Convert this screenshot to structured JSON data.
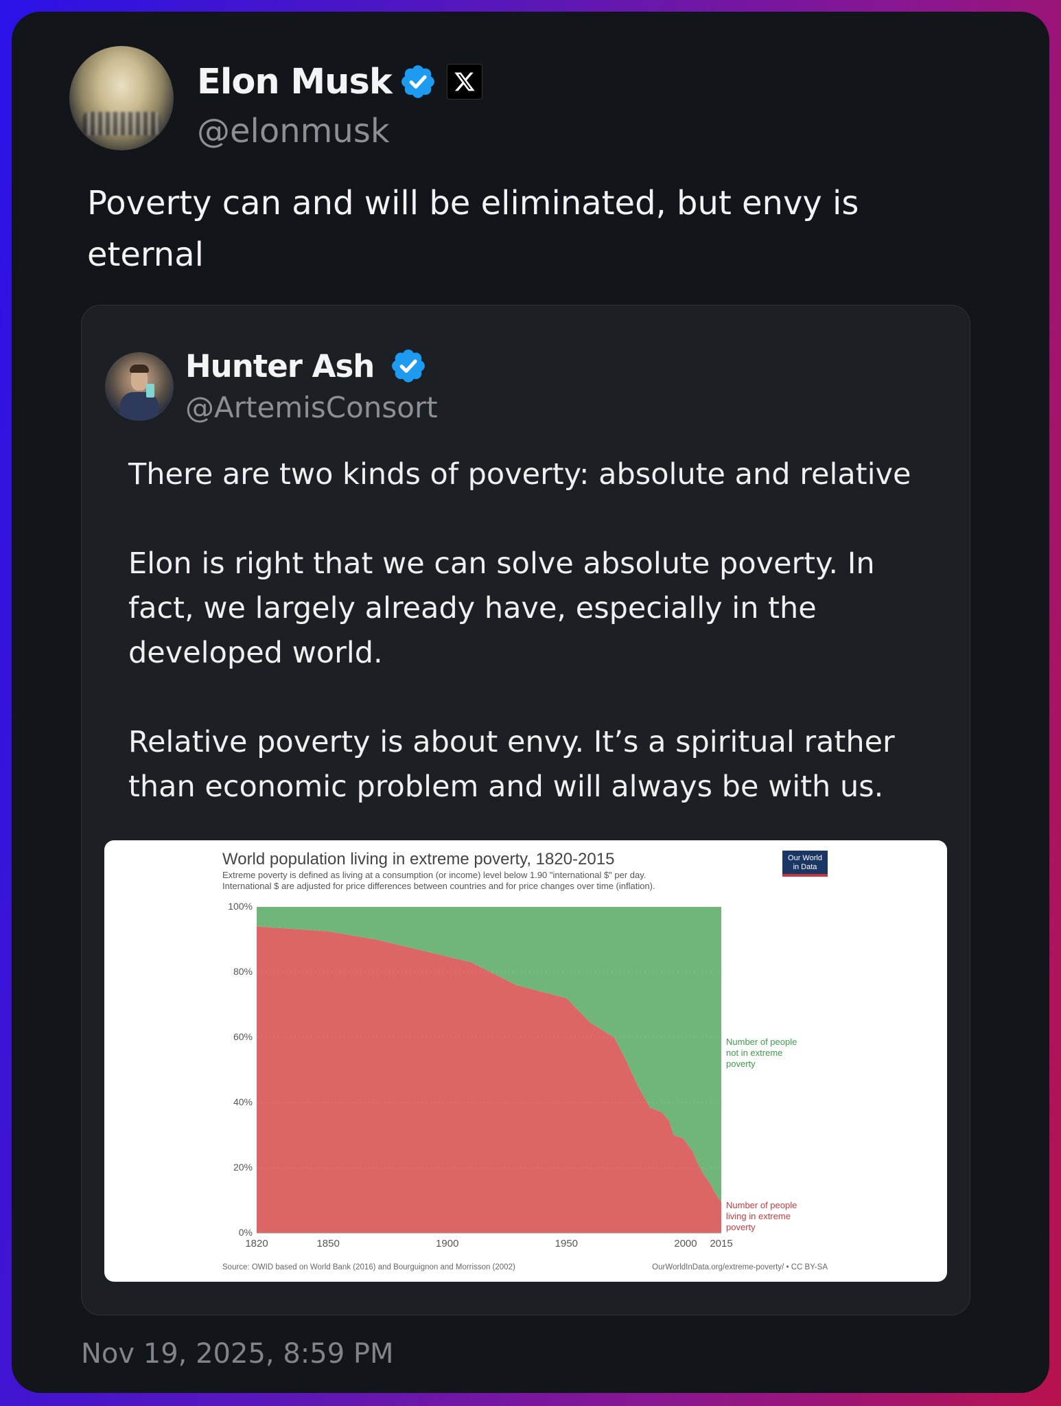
{
  "post": {
    "author": {
      "name": "Elon Musk",
      "handle": "@elonmusk",
      "verified_icon": "verified-badge-icon",
      "logo_icon": "x-logo-icon"
    },
    "text": "Poverty can and will be eliminated, but envy is\neternal",
    "timestamp": "Nov 19, 2025, 8:59 PM"
  },
  "quoted_post": {
    "author": {
      "name": "Hunter Ash",
      "handle": "@ArtemisConsort",
      "verified_icon": "verified-badge-icon"
    },
    "text": "There are two kinds of poverty: absolute and relative\n\nElon is right that we can solve absolute poverty. In fact, we largely already have, especially in the developed world.\n\nRelative poverty is about envy. It’s a spiritual rather than economic problem and will always be with us."
  },
  "colors": {
    "background": "#12161a",
    "quote_background": "#1c2024",
    "verified": "#1d9bf0",
    "poverty": "#dc6565",
    "not_poverty": "#70b57a"
  },
  "chart_data": {
    "type": "area",
    "title": "World population living in extreme poverty, 1820-2015",
    "subtitle_lines": [
      "Extreme poverty is defined as living at a consumption (or income) level below 1.90 \"international $\" per day.",
      "International $ are adjusted for price differences between countries and for price changes over time (inflation)."
    ],
    "logo_lines": [
      "Our World",
      "in Data"
    ],
    "x_ticks": [
      "1820",
      "1850",
      "1900",
      "1950",
      "2000",
      "2015"
    ],
    "y_ticks": [
      "0%",
      "20%",
      "40%",
      "60%",
      "80%",
      "100%"
    ],
    "xlim": [
      1820,
      2015
    ],
    "ylim": [
      0,
      100
    ],
    "stacked": true,
    "series": [
      {
        "name": "Number of people living in extreme poverty",
        "label_lines": [
          "Number of people",
          "living in extreme",
          "poverty"
        ],
        "color": "#dc6565",
        "points": [
          [
            1820,
            94
          ],
          [
            1850,
            92.5
          ],
          [
            1870,
            90
          ],
          [
            1890,
            86.5
          ],
          [
            1910,
            83
          ],
          [
            1929,
            76
          ],
          [
            1950,
            72
          ],
          [
            1960,
            64.5
          ],
          [
            1970,
            60
          ],
          [
            1975,
            53
          ],
          [
            1980,
            45
          ],
          [
            1985,
            38.5
          ],
          [
            1990,
            37
          ],
          [
            1993,
            34.5
          ],
          [
            1995,
            30
          ],
          [
            1999,
            29
          ],
          [
            2003,
            25
          ],
          [
            2005,
            21.5
          ],
          [
            2008,
            17.5
          ],
          [
            2010,
            15.5
          ],
          [
            2013,
            11.5
          ],
          [
            2015,
            9.5
          ]
        ]
      },
      {
        "name": "Number of people not in extreme poverty",
        "label_lines": [
          "Number of people",
          "not in extreme",
          "poverty"
        ],
        "color": "#70b57a"
      }
    ],
    "source": "Source: OWID based on World Bank (2016) and Bourguignon and Morrisson (2002)",
    "license": "OurWorldInData.org/extreme-poverty/ • CC BY-SA"
  }
}
